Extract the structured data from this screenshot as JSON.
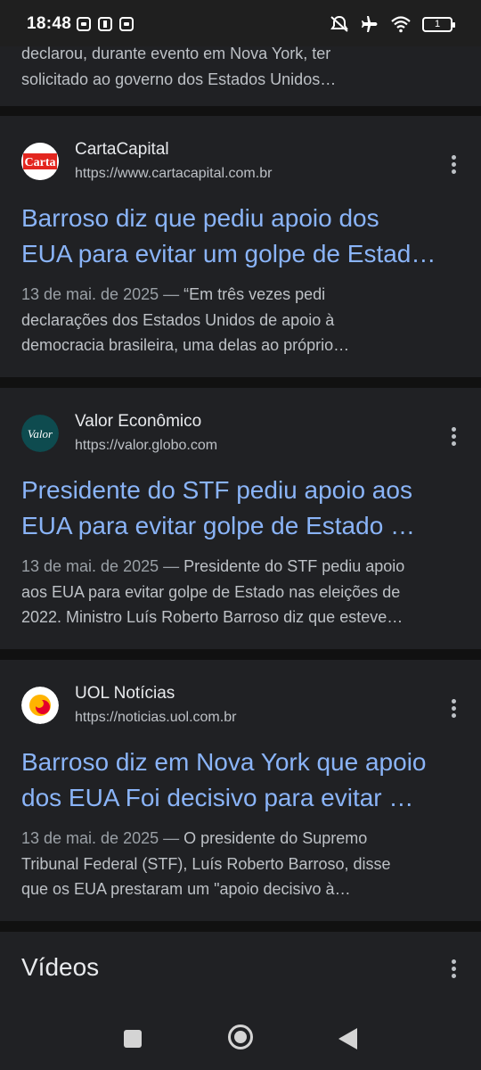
{
  "status_bar": {
    "time": "18:48",
    "battery_level": "1"
  },
  "top_snippet": {
    "line1": "declarou, durante evento em Nova York, ter",
    "line2": "solicitado ao governo dos Estados Unidos…"
  },
  "results": [
    {
      "source": "CartaCapital",
      "url": "https://www.cartacapital.com.br",
      "favicon_text": "Carta",
      "title_line1": "Barroso diz que pediu apoio dos",
      "title_line2": "EUA para evitar um golpe de Estad…",
      "date": "13 de mai. de 2025 —",
      "snippet_line1": " “Em três vezes pedi",
      "snippet_line2": "declarações dos Estados Unidos de apoio à",
      "snippet_line3": "democracia brasileira, uma delas ao próprio…"
    },
    {
      "source": "Valor Econômico",
      "url": "https://valor.globo.com",
      "favicon_text": "Valor",
      "title_line1": "Presidente do STF pediu apoio aos",
      "title_line2": "EUA para evitar golpe de Estado …",
      "date": "13 de mai. de 2025 —",
      "snippet_line1": " Presidente do STF pediu apoio",
      "snippet_line2": "aos EUA para evitar golpe de Estado nas eleições de",
      "snippet_line3": "2022. Ministro Luís Roberto Barroso diz que esteve…"
    },
    {
      "source": "UOL Notícias",
      "url": "https://noticias.uol.com.br",
      "favicon_text": "",
      "title_line1": "Barroso diz em Nova York que apoio",
      "title_line2": "dos EUA Foi decisivo para evitar …",
      "date": "13 de mai. de 2025 —",
      "snippet_line1": " O presidente do Supremo",
      "snippet_line2": "Tribunal Federal (STF), Luís Roberto Barroso, disse",
      "snippet_line3": "que os EUA prestaram um \"apoio decisivo à…"
    }
  ],
  "videos_section": {
    "title": "Vídeos"
  },
  "colors": {
    "background": "#111111",
    "card": "#202124",
    "link": "#8ab4f8",
    "text": "#e8eaed",
    "secondary_text": "#bdc1c6",
    "carta_red": "#e3261f",
    "valor_teal": "#0e4b4f",
    "uol_yellow": "#ffb400"
  }
}
